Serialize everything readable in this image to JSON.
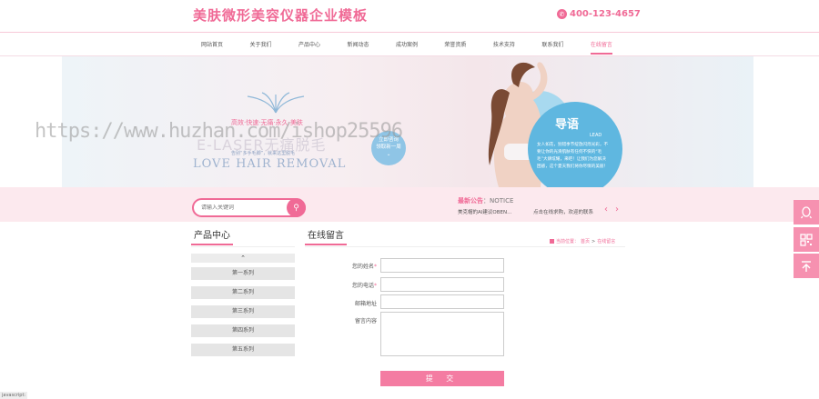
{
  "header": {
    "logo_text": "美肤微形美容仪器企业模板",
    "phone": "400-123-4657",
    "phone_icon": "phone-icon"
  },
  "nav": {
    "items": [
      "网站首页",
      "关于我们",
      "产品中心",
      "新闻动态",
      "成功案例",
      "荣誉资质",
      "技术支持",
      "联系我们",
      "在线留言"
    ],
    "active_index": 8
  },
  "banner": {
    "tagline": "高效·快速·无痛·永久·美肤",
    "title_en_laser": "E-LASER无痛脱毛",
    "slogan": "告别“多手毛脚”，就来这里脱毛",
    "title_en": "LOVE HAIR REMOVAL",
    "consult_line1": "立即咨询",
    "consult_line2": "领取新一周",
    "guide_title": "导语",
    "guide_lead": "LEAD",
    "guide_text": "女人如花，别错季节绽放闪烁光彩，不要让你的光滑肌肤有任何不快的“毛毛”大肆炫耀，来吧！让我们为您解决困惑，这个夏天我们将你尽情的美丽！"
  },
  "watermark": "https://www.huzhan.com/ishop25596",
  "search": {
    "placeholder": "请输入关键词",
    "button_icon": "search-icon"
  },
  "notice": {
    "label": "最新公告",
    "label_en": "：NOTICE",
    "items": [
      "美克帽的AI建议OBEN...",
      "点击在线求购，欢迎的联系"
    ]
  },
  "sidebar_float": {
    "icons": [
      "qq-icon",
      "qr-code-icon",
      "back-to-top-icon"
    ]
  },
  "products": {
    "title": "产品中心",
    "categories": [
      "第一系列",
      "第二系列",
      "第三系列",
      "第四系列",
      "第五系列"
    ]
  },
  "message": {
    "title": "在线留言",
    "breadcrumb_label": "当前位置：",
    "breadcrumb_home": "首页",
    "breadcrumb_sep": " > ",
    "breadcrumb_current": "在线留言",
    "fields": [
      {
        "label": "您的姓名",
        "required": "*"
      },
      {
        "label": "您的电话",
        "required": "*"
      },
      {
        "label": "邮箱地址",
        "required": ""
      },
      {
        "label": "留言内容",
        "required": ""
      }
    ],
    "submit": "提 交"
  },
  "statusbar": {
    "text": "javascript:"
  },
  "colors": {
    "accent": "#f06a96",
    "banner_blue": "#5fb7e0",
    "strip_bg": "#fce9ee"
  }
}
